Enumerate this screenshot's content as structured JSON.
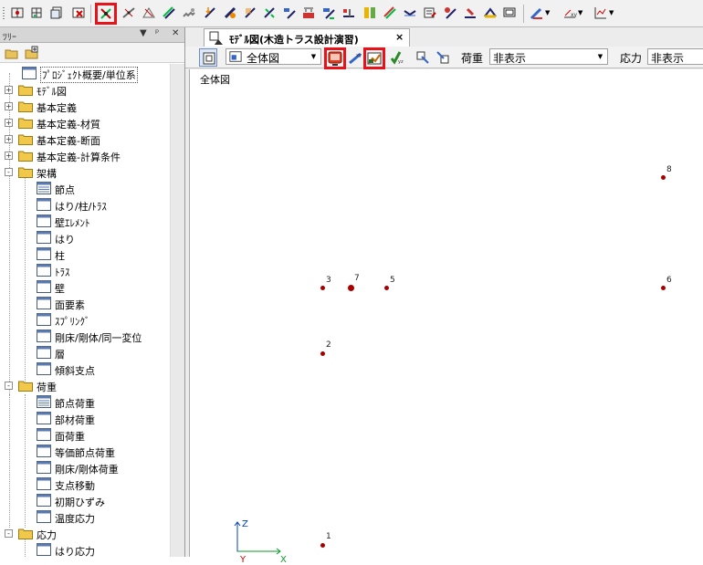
{
  "colors": {
    "highlight": "#e8121b",
    "node": "#a80000",
    "axis_x": "#009e00",
    "axis_y": "#e00000",
    "axis_z": "#0040c0"
  },
  "toolbar": {
    "buttons": [
      "node-frame-icon",
      "grid-icon",
      "grid-view-icon",
      "delete-grid-icon",
      "node-select-icon",
      "beam-icon",
      "truss-icon",
      "support-icon",
      "spring-icon",
      "load-icon",
      "member-load-icon",
      "distributed-load-icon",
      "moment-icon",
      "support-move-icon",
      "settlement-icon",
      "section-icon",
      "brace-icon",
      "member-check-icon",
      "plate-icon",
      "connection-icon",
      "surface-icon",
      "view-icon",
      "floor-icon",
      "wall-icon",
      "panel-icon"
    ],
    "dropdowns": [
      "paint-icon",
      "measure-icon",
      "chart-icon"
    ]
  },
  "tree": {
    "title": "ﾂﾘｰ",
    "items": [
      {
        "label": "ﾌﾟﾛｼﾞｪｸﾄ概要/単位系",
        "level": 1,
        "icon": "doc",
        "selected": true
      },
      {
        "label": "ﾓﾃﾞﾙ図",
        "level": 0,
        "icon": "folder",
        "expand": "+"
      },
      {
        "label": "基本定義",
        "level": 0,
        "icon": "folder",
        "expand": "+"
      },
      {
        "label": "基本定義-材質",
        "level": 0,
        "icon": "folder",
        "expand": "+"
      },
      {
        "label": "基本定義-断面",
        "level": 0,
        "icon": "folder",
        "expand": "+"
      },
      {
        "label": "基本定義-計算条件",
        "level": 0,
        "icon": "folder",
        "expand": "+"
      },
      {
        "label": "架構",
        "level": 0,
        "icon": "folder",
        "expand": "-"
      },
      {
        "label": "節点",
        "level": 1,
        "icon": "doc-lines"
      },
      {
        "label": "はり/柱/ﾄﾗｽ",
        "level": 1,
        "icon": "doc"
      },
      {
        "label": "壁ｴﾚﾒﾝﾄ",
        "level": 1,
        "icon": "doc"
      },
      {
        "label": "はり",
        "level": 1,
        "icon": "doc"
      },
      {
        "label": "柱",
        "level": 1,
        "icon": "doc"
      },
      {
        "label": "ﾄﾗｽ",
        "level": 1,
        "icon": "doc"
      },
      {
        "label": "壁",
        "level": 1,
        "icon": "doc"
      },
      {
        "label": "面要素",
        "level": 1,
        "icon": "doc"
      },
      {
        "label": "ｽﾌﾟﾘﾝｸﾞ",
        "level": 1,
        "icon": "doc"
      },
      {
        "label": "剛床/剛体/同一変位",
        "level": 1,
        "icon": "doc"
      },
      {
        "label": "層",
        "level": 1,
        "icon": "doc"
      },
      {
        "label": "傾斜支点",
        "level": 1,
        "icon": "doc"
      },
      {
        "label": "荷重",
        "level": 0,
        "icon": "folder",
        "expand": "-"
      },
      {
        "label": "節点荷重",
        "level": 1,
        "icon": "doc-lines"
      },
      {
        "label": "部材荷重",
        "level": 1,
        "icon": "doc"
      },
      {
        "label": "面荷重",
        "level": 1,
        "icon": "doc"
      },
      {
        "label": "等価節点荷重",
        "level": 1,
        "icon": "doc"
      },
      {
        "label": "剛床/剛体荷重",
        "level": 1,
        "icon": "doc"
      },
      {
        "label": "支点移動",
        "level": 1,
        "icon": "doc"
      },
      {
        "label": "初期ひずみ",
        "level": 1,
        "icon": "doc"
      },
      {
        "label": "温度応力",
        "level": 1,
        "icon": "doc"
      },
      {
        "label": "応力",
        "level": 0,
        "icon": "folder",
        "expand": "-"
      },
      {
        "label": "はり応力",
        "level": 1,
        "icon": "doc"
      }
    ]
  },
  "tab": {
    "label": "ﾓﾃﾞﾙ図(木造トラス設計演習)",
    "close": "×"
  },
  "view_toolbar": {
    "view_combo": "全体図",
    "load_label": "荷重",
    "load_combo": "非表示",
    "stress_label": "応力",
    "stress_combo": "非表示"
  },
  "canvas": {
    "caption": "全体図",
    "nodes": [
      {
        "id": "1"
      },
      {
        "id": "2"
      },
      {
        "id": "3"
      },
      {
        "id": "5"
      },
      {
        "id": "6"
      },
      {
        "id": "7"
      },
      {
        "id": "8"
      }
    ],
    "axis": {
      "z": "Z",
      "x": "X",
      "y": "Y"
    }
  }
}
